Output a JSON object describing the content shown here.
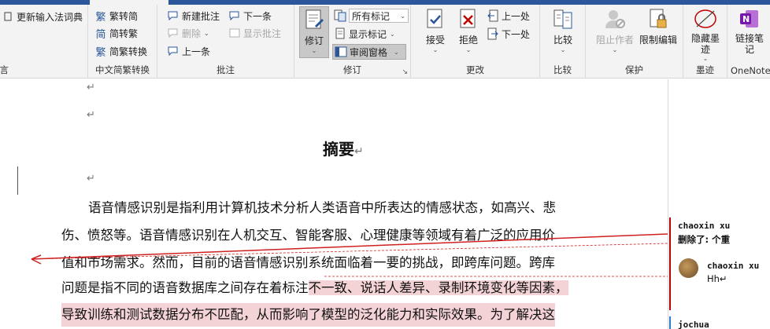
{
  "ribbon": {
    "partial_left": {
      "update_dict_label": "更新输入法词典",
      "group_label_fragment": "语言"
    },
    "chinese_conversion": {
      "to_traditional": "繁转简",
      "to_simplified": "简转繁",
      "conversion": "简繁转换",
      "group_label": "中文简繁转换"
    },
    "comments": {
      "new_comment": "新建批注",
      "delete": "删除",
      "previous": "上一条",
      "next": "下一条",
      "show_comments": "显示批注",
      "group_label": "批注"
    },
    "tracking": {
      "track_changes": "修订",
      "markup_select": "所有标记",
      "show_markup": "显示标记",
      "reviewing_pane": "审阅窗格",
      "group_label": "修订"
    },
    "changes": {
      "accept": "接受",
      "reject": "拒绝",
      "previous": "上一处",
      "next": "下一处",
      "group_label": "更改"
    },
    "compare": {
      "compare": "比较",
      "group_label": "比较"
    },
    "protect": {
      "block_authors": "阻止作者",
      "restrict_editing": "限制编辑",
      "group_label": "保护"
    },
    "ink": {
      "hide_ink": "隐藏墨迹",
      "group_label": "墨迹"
    },
    "onenote": {
      "linked_notes": "链接笔记",
      "group_label": "OneNote"
    }
  },
  "document": {
    "title": "摘要",
    "para_mark": "↵",
    "lines": [
      "语音情感识别是指利用计算机技术分析人类语音中所表达的情感状态，如高兴、悲",
      "伤、愤怒等。语音情感识别在人机交互、智能客服、心理健康等领域有着广泛的应用价",
      "值和市场需求。然而，目前的语音情感识别系统面临着一要的挑战，即跨库问题。跨库",
      "问题是指不同的语音数据库之间存在着标注",
      "不一致、说话人差异、录制环境变化等因素，",
      "导致训练和测试数据分布不匹配，从而影响了模型的泛化能力和实际效果。为了解决这"
    ]
  },
  "comments_pane": {
    "items": [
      {
        "author": "chaoxin xu",
        "text": "删除了: 个重"
      },
      {
        "author": "chaoxin xu",
        "text": "Hh↵"
      },
      {
        "author": "jochua",
        "text": ""
      }
    ]
  },
  "colors": {
    "accent": "#2b579a",
    "revision_red": "#c00000",
    "highlight": "#f4d3d6"
  }
}
